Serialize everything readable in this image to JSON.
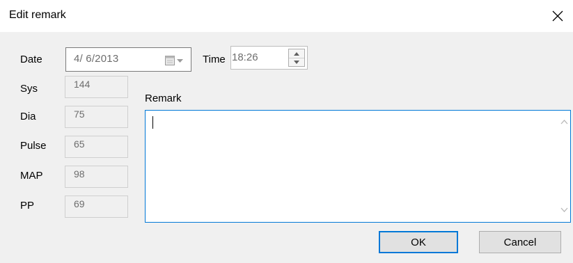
{
  "dialog": {
    "title": "Edit remark"
  },
  "form": {
    "date_label": "Date",
    "date_value": "4/  6/2013",
    "time_label": "Time",
    "time_value": "18:26",
    "sys_label": "Sys",
    "sys_value": "144",
    "dia_label": "Dia",
    "dia_value": "75",
    "pulse_label": "Pulse",
    "pulse_value": "65",
    "map_label": "MAP",
    "map_value": "98",
    "pp_label": "PP",
    "pp_value": "69",
    "remark_label": "Remark",
    "remark_value": ""
  },
  "buttons": {
    "ok_label": "OK",
    "cancel_label": "Cancel"
  },
  "colors": {
    "focus_accent": "#0078d7",
    "client_background": "#f0f0f0",
    "disabled_text": "#6d6d6d"
  },
  "icons": [
    "close-icon",
    "calendar-icon",
    "chevron-down-icon",
    "spin-up-icon",
    "spin-down-icon",
    "scroll-up-icon",
    "scroll-down-icon"
  ]
}
